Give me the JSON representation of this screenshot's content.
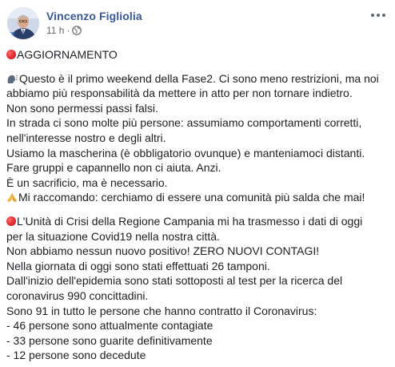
{
  "post": {
    "author": "Vincenzo Figliolia",
    "timestamp": "11 h",
    "separator": "·",
    "privacy_icon": "globe-icon",
    "more_icon": "ellipsis-icon"
  },
  "content": {
    "heading": "AGGIORNAMENTO",
    "para1": [
      "Questo è il primo weekend della Fase2. Ci sono meno restrizioni, ma noi",
      "abbiamo più responsabilità da mettere in atto per non tornare indietro.",
      "Non sono permessi passi falsi.",
      "In strada ci sono molte più persone: assumiamo comportamenti corretti,",
      "nell'interesse nostro e degli altri.",
      "Usiamo la mascherina (è obbligatorio ovunque) e manteniamoci distanti.",
      "Fare gruppi e capannello non ci aiuta. Anzi.",
      "È un sacrificio, ma è necessario.",
      "Mi raccomando: cerchiamo di essere una comunità più salda che mai!"
    ],
    "para2": [
      "L'Unità di Crisi della Regione Campania mi ha trasmesso i dati di oggi",
      "per la situazione Covid19 nella nostra città.",
      "Non abbiamo nessun nuovo positivo! ZERO NUOVI CONTAGI!",
      "Nella giornata di oggi sono stati effettuati 26 tamponi.",
      "Dall'inizio dell'epidemia sono stati sottoposti al test per la ricerca del",
      "coronavirus 990 concittadini.",
      "Sono 91 in tutto le persone che hanno contratto il Coronavirus:",
      "- 46 persone sono attualmente contagiate",
      "- 33 persone sono guarite definitivamente",
      "- 12 persone sono decedute"
    ]
  },
  "colors": {
    "author": "#385898",
    "meta": "#616770",
    "text": "#1c1e21",
    "red_circle": "#e0282e"
  }
}
